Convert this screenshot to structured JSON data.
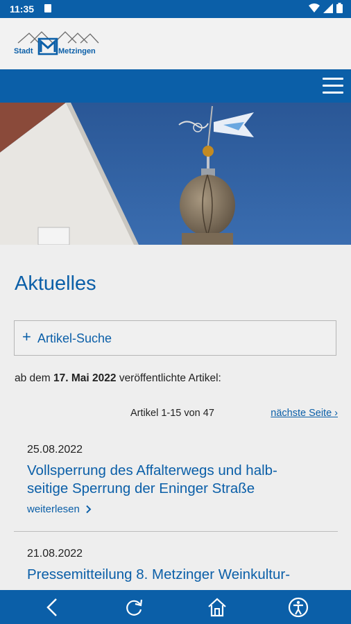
{
  "status_bar": {
    "time": "11:35"
  },
  "header": {
    "logo_text_left": "Stadt",
    "logo_text_right": "Metzingen"
  },
  "page": {
    "title": "Aktuelles"
  },
  "search": {
    "label": "Artikel-Suche",
    "toggle_symbol": "+"
  },
  "published": {
    "prefix": "ab dem",
    "date": "17. Mai 2022",
    "suffix": "veröffentlichte Artikel:"
  },
  "paging": {
    "count": "Artikel 1-15 von 47",
    "next": "nächste Seite ›"
  },
  "articles": [
    {
      "date": "25.08.2022",
      "title": "Vollsperrung des Affalterwegs und halb-\nseitige Sperrung der Eninger Straße",
      "more": "weiterlesen"
    },
    {
      "date": "21.08.2022",
      "title": "Pressemitteilung 8. Metzinger Weinkultur-",
      "more": ""
    }
  ],
  "bottom_nav": {
    "items": [
      "back-icon",
      "reload-icon",
      "home-icon",
      "accessibility-icon"
    ]
  },
  "colors": {
    "brand_blue": "#0b5fa8",
    "background": "#eeeeee"
  }
}
